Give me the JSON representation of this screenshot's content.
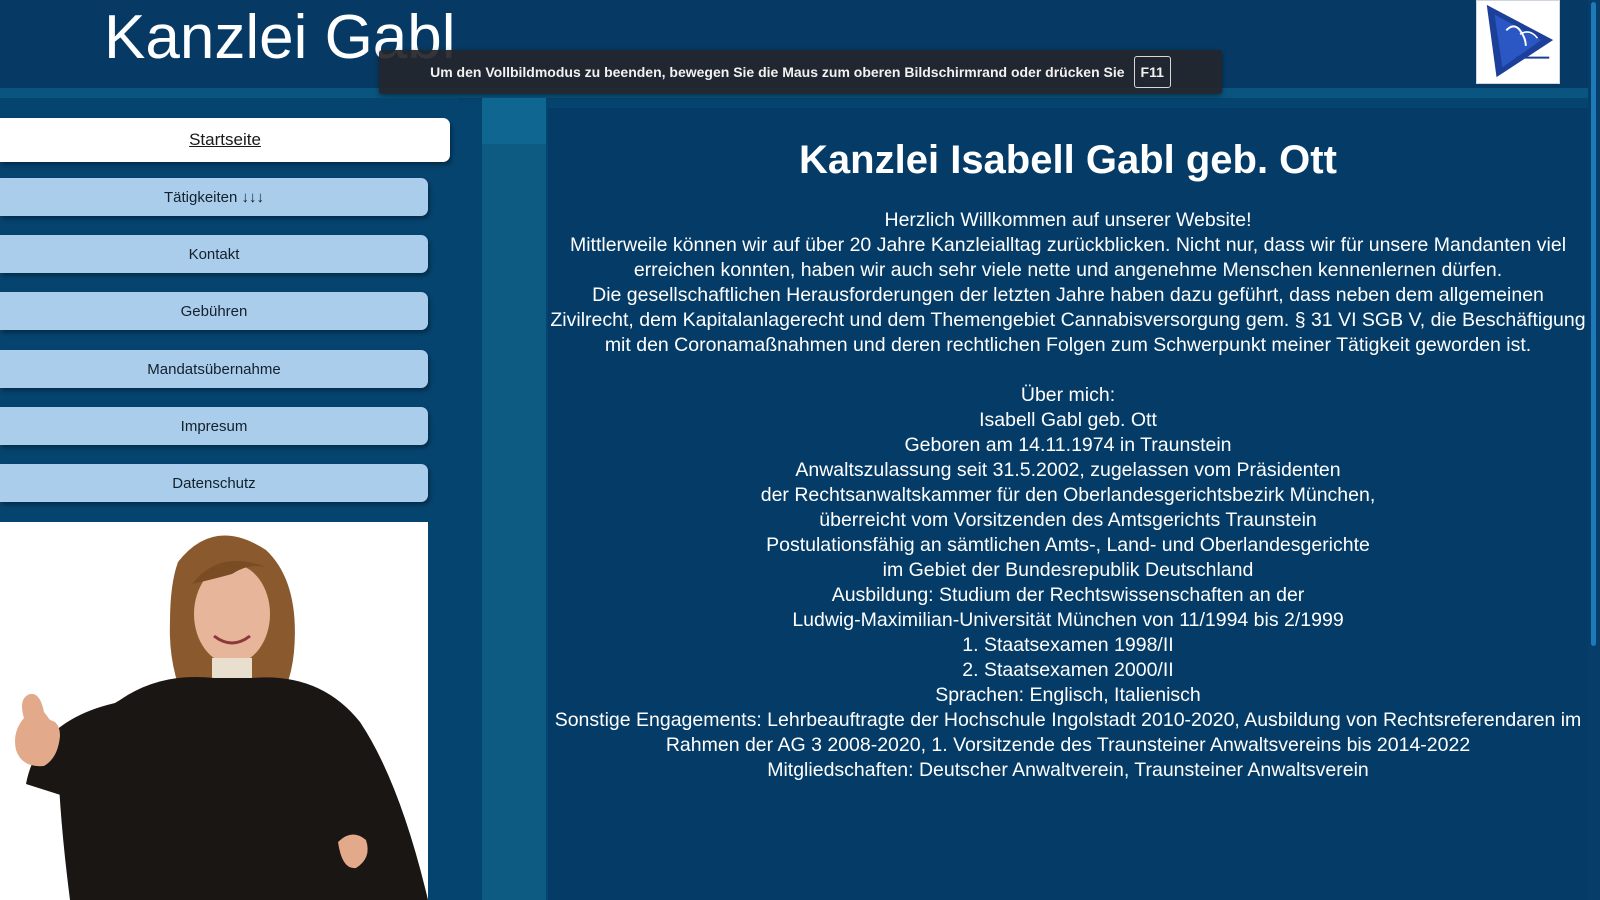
{
  "header": {
    "site_title": "Kanzlei Gabl",
    "fullscreen_notice": "Um den Vollbildmodus zu beenden, bewegen Sie die Maus zum oberen Bildschirmrand oder drücken Sie",
    "fullscreen_key": "F11"
  },
  "nav": {
    "items": [
      {
        "label": "Startseite"
      },
      {
        "label": "Tätigkeiten ↓↓↓"
      },
      {
        "label": "Kontakt"
      },
      {
        "label": "Gebühren"
      },
      {
        "label": "Mandatsübernahme"
      },
      {
        "label": "Impresum"
      },
      {
        "label": "Datenschutz"
      }
    ]
  },
  "main": {
    "heading": "Kanzlei Isabell Gabl geb. Ott",
    "welcome": "Herzlich Willkommen auf unserer Website!",
    "intro1": "Mittlerweile können wir auf über 20 Jahre Kanzleialltag zurückblicken. Nicht nur, dass wir für unsere Mandanten viel erreichen konnten, haben wir auch sehr viele nette und angenehme Menschen kennenlernen dürfen.",
    "intro2": "Die gesellschaftlichen Herausforderungen der letzten Jahre haben dazu geführt, dass neben dem allgemeinen Zivilrecht, dem Kapitalanlagerecht und dem Themengebiet Cannabisversorgung gem. § 31 VI SGB V, die Beschäftigung mit den Coronamaßnahmen und deren rechtlichen Folgen zum Schwerpunkt meiner Tätigkeit geworden ist.",
    "about_heading": "Über mich:",
    "about_lines": [
      "Isabell Gabl geb. Ott",
      "Geboren am 14.11.1974 in Traunstein",
      "Anwaltszulassung seit 31.5.2002, zugelassen vom Präsidenten",
      "der Rechtsanwaltskammer für den Oberlandesgerichtsbezirk München,",
      "überreicht vom Vorsitzenden des Amtsgerichts Traunstein",
      "Postulationsfähig an sämtlichen Amts-, Land- und Oberlandesgerichte",
      "im Gebiet der Bundesrepublik Deutschland",
      "Ausbildung: Studium der Rechtswissenschaften an der",
      "Ludwig-Maximilian-Universität München von 11/1994 bis 2/1999",
      "1. Staatsexamen 1998/II",
      "2. Staatsexamen 2000/II",
      "Sprachen: Englisch, Italienisch",
      "Sonstige Engagements: Lehrbeauftragte der Hochschule Ingolstadt 2010-2020, Ausbildung von Rechtsreferendaren im Rahmen der AG 3 2008-2020, 1. Vorsitzende des Traunsteiner Anwaltsvereins bis 2014-2022",
      "Mitgliedschaften: Deutscher Anwaltverein, Traunsteiner Anwaltsverein"
    ]
  },
  "colors": {
    "page_bg": "#064470",
    "header_bg": "#063a64",
    "nav_button": "#a9cdea",
    "nav_active": "#ffffff",
    "content_bg": "#053c67",
    "scroll_thumb": "#1d79b8"
  },
  "icons": {
    "logo": "kanzlei-logo-icon"
  }
}
